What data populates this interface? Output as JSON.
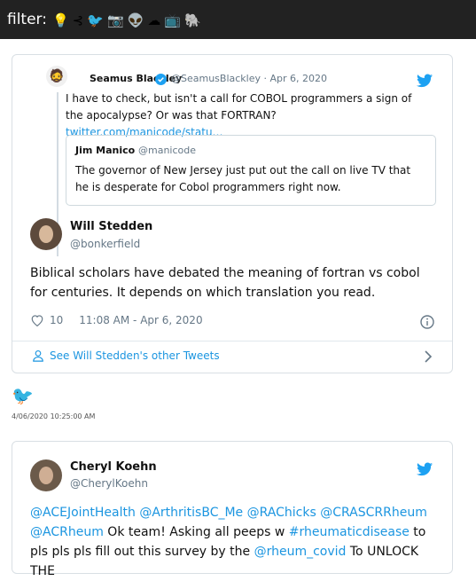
{
  "topbar": {
    "filter_label": "filter:",
    "filter_icons": [
      {
        "icon": "lightbulb-icon",
        "glyph": "💡"
      },
      {
        "icon": "bluesky-fork-icon",
        "glyph": "⊰"
      },
      {
        "icon": "red-bird-icon",
        "glyph": "🐦"
      },
      {
        "icon": "camera-icon",
        "glyph": "📷"
      },
      {
        "icon": "alien-icon",
        "glyph": "👽"
      },
      {
        "icon": "cloud-icon",
        "glyph": "☁"
      },
      {
        "icon": "tv-icon",
        "glyph": "📺"
      },
      {
        "icon": "elephant-icon",
        "glyph": "🐘"
      }
    ]
  },
  "card1": {
    "quoted": {
      "name": "Seamus Blackley",
      "handle_date": "@SeamusBlackley · Apr 6, 2020",
      "text": "I have to check, but isn't a call for COBOL programmers a sign of the apocalypse? Or was that FORTRAN? ",
      "link": "twitter.com/manicode/statu…",
      "inner": {
        "name": "Jim Manico",
        "handle": "@manicode",
        "text": "The governor of New Jersey just put out the call on live TV that he is desperate for Cobol programmers right now."
      }
    },
    "author": {
      "name": "Will Stedden",
      "handle": "@bonkerfield"
    },
    "text": "Biblical scholars have debated the meaning of fortran vs cobol for centuries. It depends on which translation you read.",
    "likes": "10",
    "time": "11:08 AM - Apr 6, 2020",
    "see_more": "See Will Stedden's other Tweets"
  },
  "bird_emoji": "🐦",
  "timestamp": "4/06/2020 10:25:00 AM",
  "card2": {
    "author": {
      "name": "Cheryl Koehn",
      "handle": "@CherylKoehn"
    },
    "text_parts": [
      {
        "t": "@ACEJointHealth",
        "m": true
      },
      {
        "t": " ",
        "m": false
      },
      {
        "t": "@ArthritisBC_Me",
        "m": true
      },
      {
        "t": " ",
        "m": false
      },
      {
        "t": "@RAChicks",
        "m": true
      },
      {
        "t": " ",
        "m": false
      },
      {
        "t": "@CRASCRRheum",
        "m": true
      },
      {
        "t": " ",
        "m": false
      },
      {
        "t": "@ACRheum",
        "m": true
      },
      {
        "t": " Ok team! Asking all peeps w ",
        "m": false
      },
      {
        "t": "#rheumaticdisease",
        "m": true
      },
      {
        "t": " to pls pls pls fill out this survey by the ",
        "m": false
      },
      {
        "t": "@rheum_covid",
        "m": true
      },
      {
        "t": " To UNLOCK THE",
        "m": false
      }
    ]
  },
  "colors": {
    "accent": "#1b95e0",
    "topbar_bg": "#222222"
  }
}
